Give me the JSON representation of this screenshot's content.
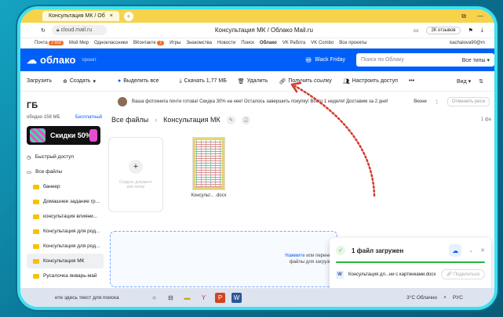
{
  "browser": {
    "tab_title": "Консультация МК / Об",
    "tab_close": "×",
    "new_tab": "+",
    "url": "cloud.mail.ru",
    "page_title": "Консультация МК / Облако Mail.ru",
    "reviews": "2К отзывов"
  },
  "bookmarks": {
    "items": [
      "Почта",
      "Мой Мир",
      "Одноклассники",
      "ВКонтакте",
      "Игры",
      "Знакомства",
      "Новости",
      "Поиск",
      "Облако",
      "VK Работа",
      "VK Combo",
      "Все проекты"
    ],
    "mail_badge": "2 658",
    "vk_badge": "2",
    "account": "kachalova90@m"
  },
  "cloud": {
    "logo": "облако",
    "project": "проект",
    "black_friday": "Black Friday",
    "search_placeholder": "Поиск по Облаку",
    "search_types": "Все типы"
  },
  "toolbar": {
    "upload": "Загрузить",
    "create": "Создать",
    "select_all": "Выделить все",
    "download": "Скачать 1,77 МБ",
    "delete": "Удалить",
    "get_link": "Получить ссылку",
    "access": "Настроить доступ",
    "more": "•••",
    "view": "Вид"
  },
  "sidebar": {
    "storage": "ГБ",
    "used": "ободно 158 МБ",
    "free": "Бесплатный",
    "promo": "Скидки 50%",
    "quick_access": "Быстрый доступ",
    "all_files": "Все файлы",
    "folders": [
      "баннер",
      "Домашнее задание гр...",
      "консультация влияни...",
      "Консультация для род...",
      "Консультация для род...",
      "Консультация МК",
      "Русалочка январь-май"
    ]
  },
  "notification": {
    "text": "Ваша фотокнига почти готова!  Скидка 30% на нее! Осталось завершить покупку! Всего 1 неделя! Доставим за 2 дня!",
    "action": "Вконе",
    "button": "Отменить реси"
  },
  "breadcrumb": {
    "root": "Все файлы",
    "current": "Консультация МК",
    "page": "1 фа"
  },
  "files": {
    "create_label": "Создать документ\nили папку",
    "doc_name": "Консульт... .docx"
  },
  "dropzone": {
    "link": "Нажмите",
    "text1": " или перенес",
    "text2": "файлы для загрузки"
  },
  "upload": {
    "title": "1 файл загружен",
    "progress": 1.0,
    "file": "Консультация дл...ни с картинками.docx",
    "share": "Поделиться"
  },
  "taskbar": {
    "search": "ите здесь текст для поиска",
    "weather": "3°C Облачно",
    "lang": "РУС"
  },
  "colors": {
    "accent": "#005ff9",
    "tab_yellow": "#f6d34a",
    "success": "#26b540",
    "arrow": "#d43a2a"
  }
}
